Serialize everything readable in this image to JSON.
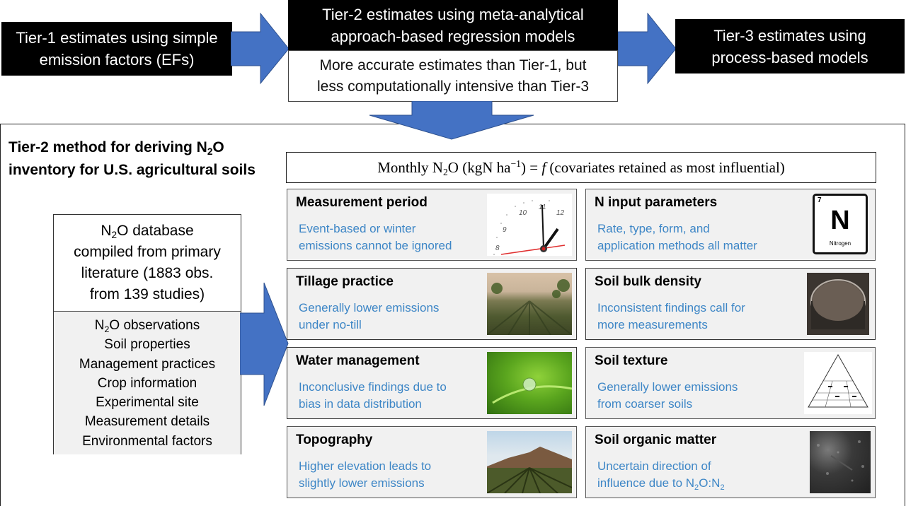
{
  "top_flow": {
    "tier1": {
      "line1": "Tier-1 estimates using simple",
      "line2": "emission factors (EFs)"
    },
    "tier2": {
      "title_line1": "Tier-2 estimates using meta-analytical",
      "title_line2": "approach-based regression models",
      "desc_line1": "More accurate estimates than Tier-1, but",
      "desc_line2": "less computationally intensive than Tier-3"
    },
    "tier3": {
      "line1": "Tier-3 estimates using",
      "line2": "process-based models"
    }
  },
  "method": {
    "title_line1_pre": "Tier-2 method for deriving N",
    "title_line1_sub": "2",
    "title_line1_post": "O",
    "title_line2": "inventory for U.S. agricultural soils"
  },
  "equation": {
    "pre": "Monthly N",
    "sub": "2",
    "mid": "O (kgN ha",
    "sup": "−1",
    "post": ") = ",
    "f": "f",
    "tail": " (covariates retained as most influential)"
  },
  "database": {
    "head_line1_pre": "N",
    "head_line1_sub": "2",
    "head_line1_post": "O database",
    "head_line2": "compiled from primary",
    "head_line3": "literature (1883 obs.",
    "head_line4": "from 139 studies)",
    "items": [
      {
        "pre": "N",
        "sub": "2",
        "post": "O observations"
      },
      {
        "pre": "Soil properties",
        "sub": "",
        "post": ""
      },
      {
        "pre": "Management practices",
        "sub": "",
        "post": ""
      },
      {
        "pre": "Crop information",
        "sub": "",
        "post": ""
      },
      {
        "pre": "Experimental site",
        "sub": "",
        "post": ""
      },
      {
        "pre": "Measurement details",
        "sub": "",
        "post": ""
      },
      {
        "pre": "Environmental factors",
        "sub": "",
        "post": ""
      }
    ]
  },
  "cards": {
    "measurement_period": {
      "title": "Measurement period",
      "desc1": "Event-based or winter",
      "desc2": "emissions cannot be ignored",
      "image": "clock-icon"
    },
    "n_input": {
      "title": "N input parameters",
      "desc1": "Rate, type, form, and",
      "desc2": "application methods all matter",
      "image": "nitrogen-element-icon",
      "element_number": "7",
      "element_symbol": "N",
      "element_name": "Nitrogen"
    },
    "tillage": {
      "title": "Tillage practice",
      "desc1": "Generally lower emissions",
      "desc2": "under no-till",
      "image": "field-photo"
    },
    "bulk_density": {
      "title": "Soil bulk density",
      "desc1": "Inconsistent findings call for",
      "desc2": "more measurements",
      "image": "soil-core-photo"
    },
    "water": {
      "title": "Water management",
      "desc1": "Inconclusive findings due to",
      "desc2": "bias in data distribution",
      "image": "water-drop-photo"
    },
    "texture": {
      "title": "Soil texture",
      "desc1": "Generally lower emissions",
      "desc2": "from coarser soils",
      "image": "texture-triangle-icon"
    },
    "topography": {
      "title": "Topography",
      "desc1": "Higher elevation leads to",
      "desc2": "slightly lower emissions",
      "image": "hill-field-photo"
    },
    "organic_matter": {
      "title": "Soil organic matter",
      "desc1": "Uncertain direction of",
      "desc2_pre": "influence due to N",
      "desc2_sub1": "2",
      "desc2_mid": "O:N",
      "desc2_sub2": "2",
      "image": "organic-soil-photo"
    }
  },
  "colors": {
    "arrow_blue": "#4472c4",
    "desc_blue": "#3d86c6",
    "card_bg": "#f1f1f1"
  }
}
